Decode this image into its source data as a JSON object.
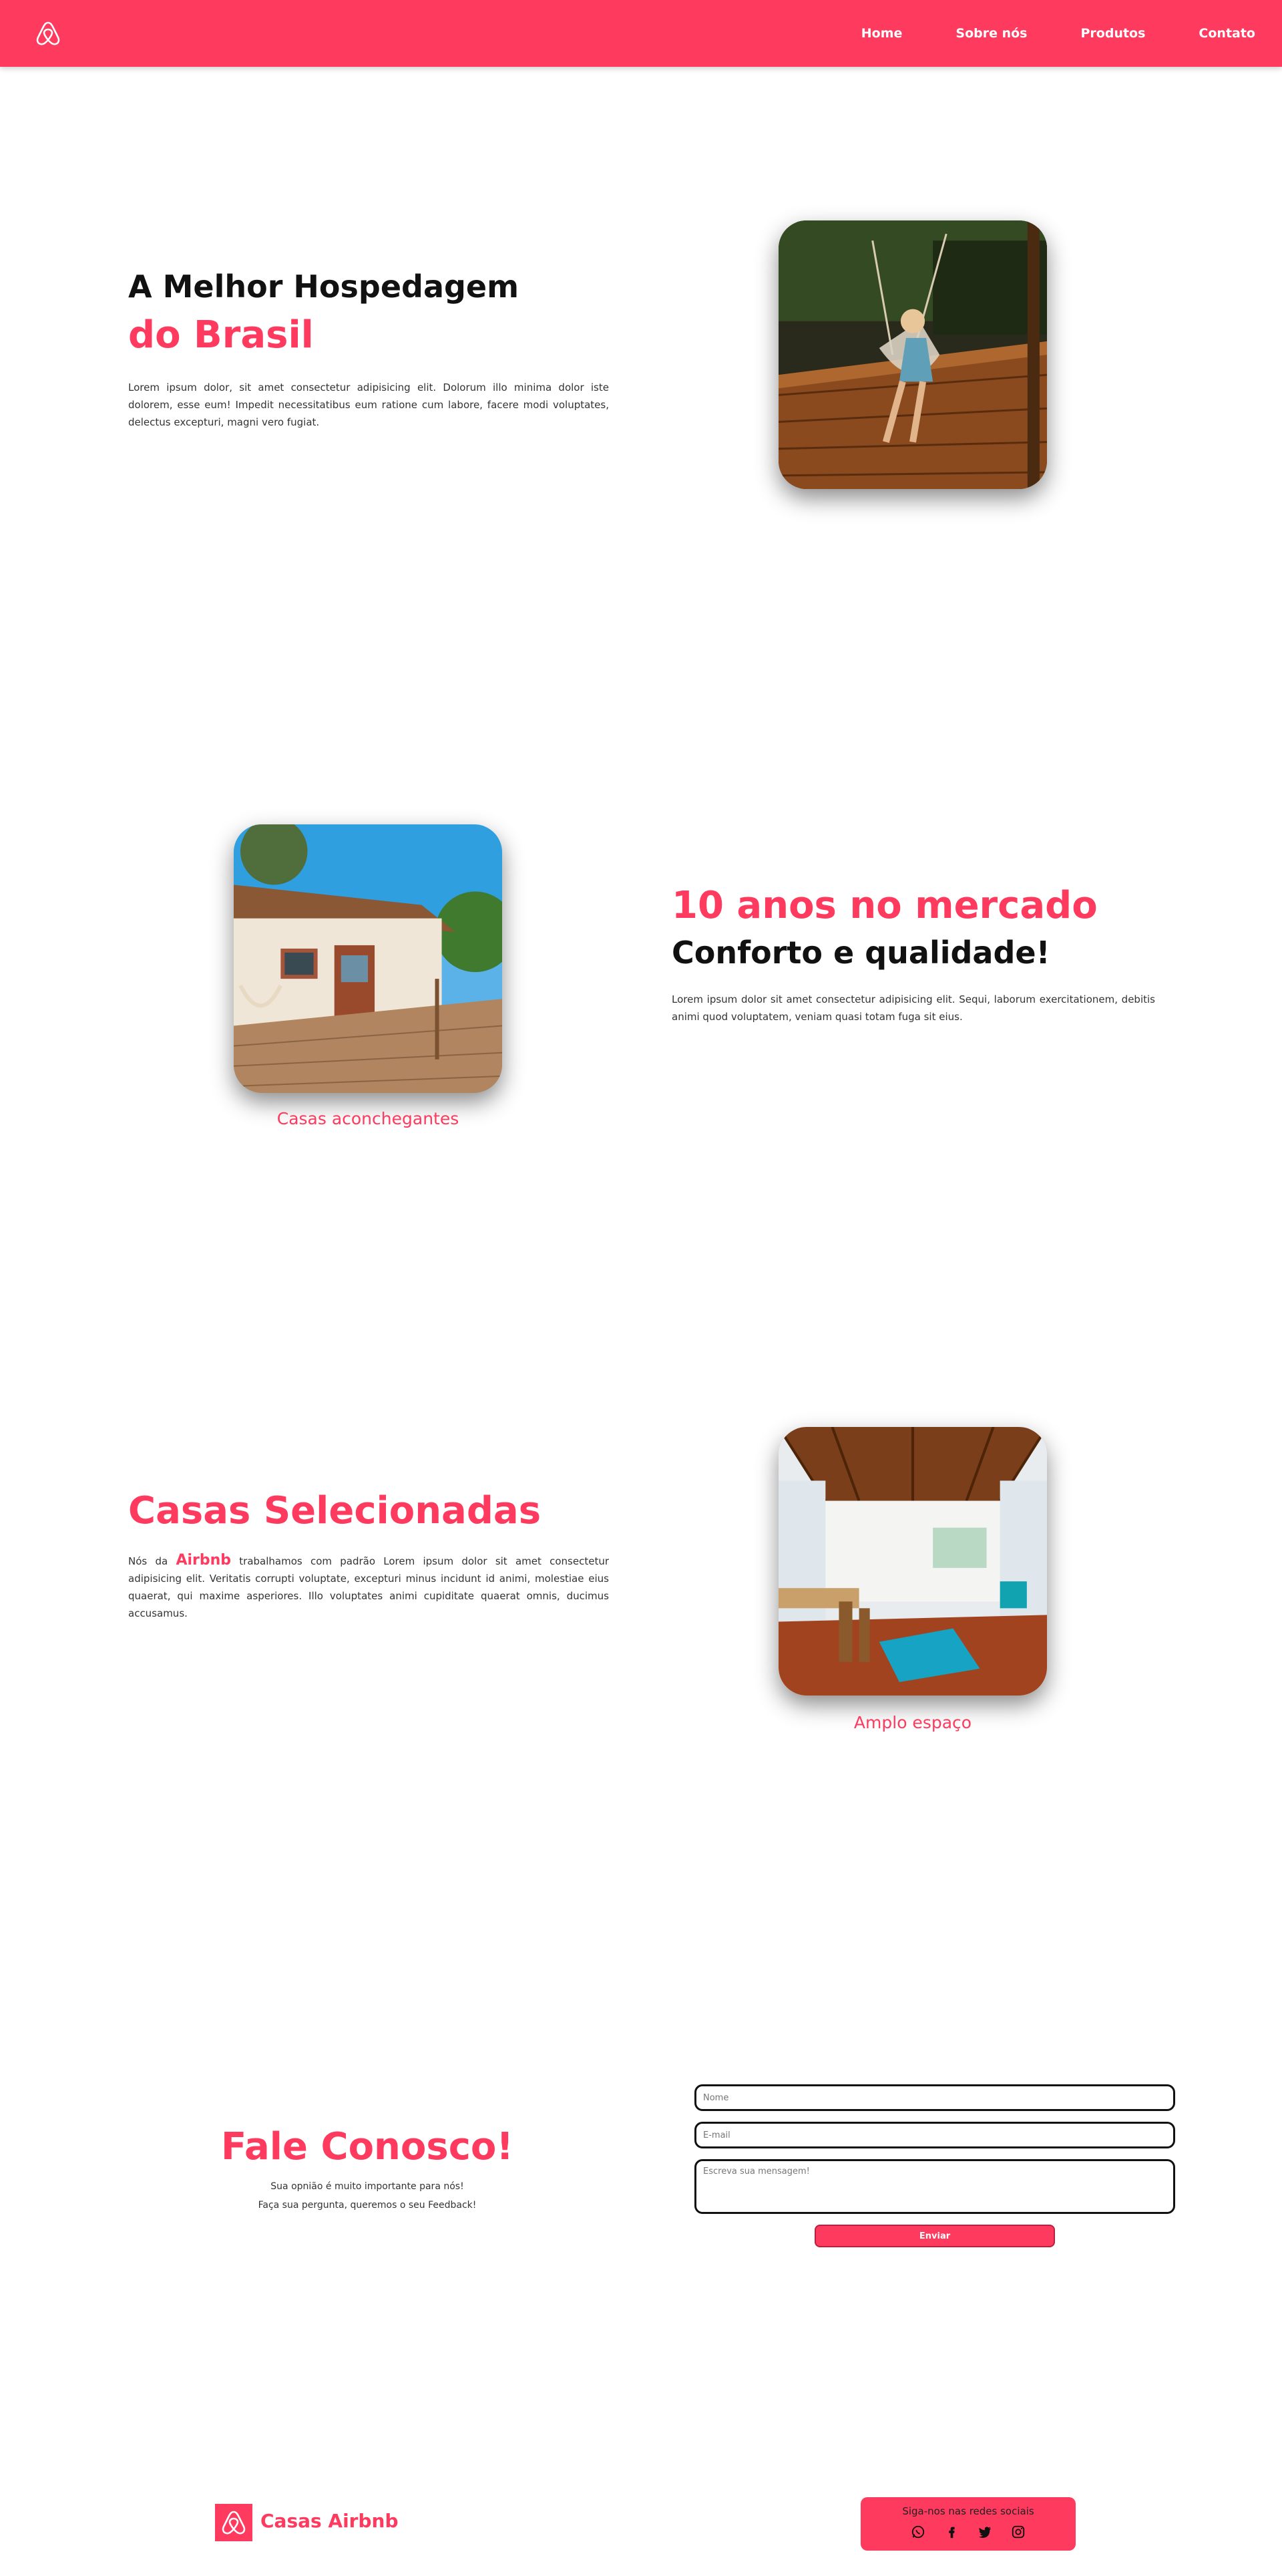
{
  "header": {
    "nav": [
      "Home",
      "Sobre nós",
      "Produtos",
      "Contato"
    ]
  },
  "hero": {
    "title_line1": "A Melhor Hospedagem",
    "title_line2": "do Brasil",
    "text": "Lorem ipsum dolor, sit amet consectetur adipisicing elit. Dolorum illo minima dolor iste dolorem, esse eum! Impedit necessitatibus eum ratione cum labore, facere modi voluptates, delectus excepturi, magni vero fugiat."
  },
  "about": {
    "title_line1": "10 anos no mercado",
    "title_line2": "Conforto e qualidade!",
    "text": "Lorem ipsum dolor sit amet consectetur adipisicing elit. Sequi, laborum exercitationem, debitis animi quod voluptatem, veniam quasi totam fuga sit eius.",
    "caption": "Casas aconchegantes"
  },
  "selected": {
    "title": "Casas Selecionadas",
    "text_before": "Nós da",
    "brand": "Airbnb",
    "text_after": "trabalhamos com padrão Lorem ipsum dolor sit amet consectetur adipisicing elit. Veritatis corrupti voluptate, excepturi minus incidunt id animi, molestiae eius quaerat, qui maxime asperiores. Illo voluptates animi cupiditate quaerat omnis, ducimus accusamus.",
    "caption": "Amplo espaço"
  },
  "contact": {
    "title": "Fale Conosco!",
    "line1": "Sua opnião é muito importante para nós!",
    "line2": "Faça sua pergunta, queremos o seu Feedback!",
    "name_placeholder": "Nome",
    "email_placeholder": "E-mail",
    "message_placeholder": "Escreva sua mensagem!",
    "send_label": "Enviar"
  },
  "footer": {
    "brand": "Casas Airbnb",
    "social_title": "Siga-nos nas redes sociais",
    "social_icons": [
      "whatsapp-icon",
      "facebook-icon",
      "twitter-icon",
      "instagram-icon"
    ]
  },
  "colors": {
    "accent": "#fe3a5e",
    "text": "#111111"
  }
}
